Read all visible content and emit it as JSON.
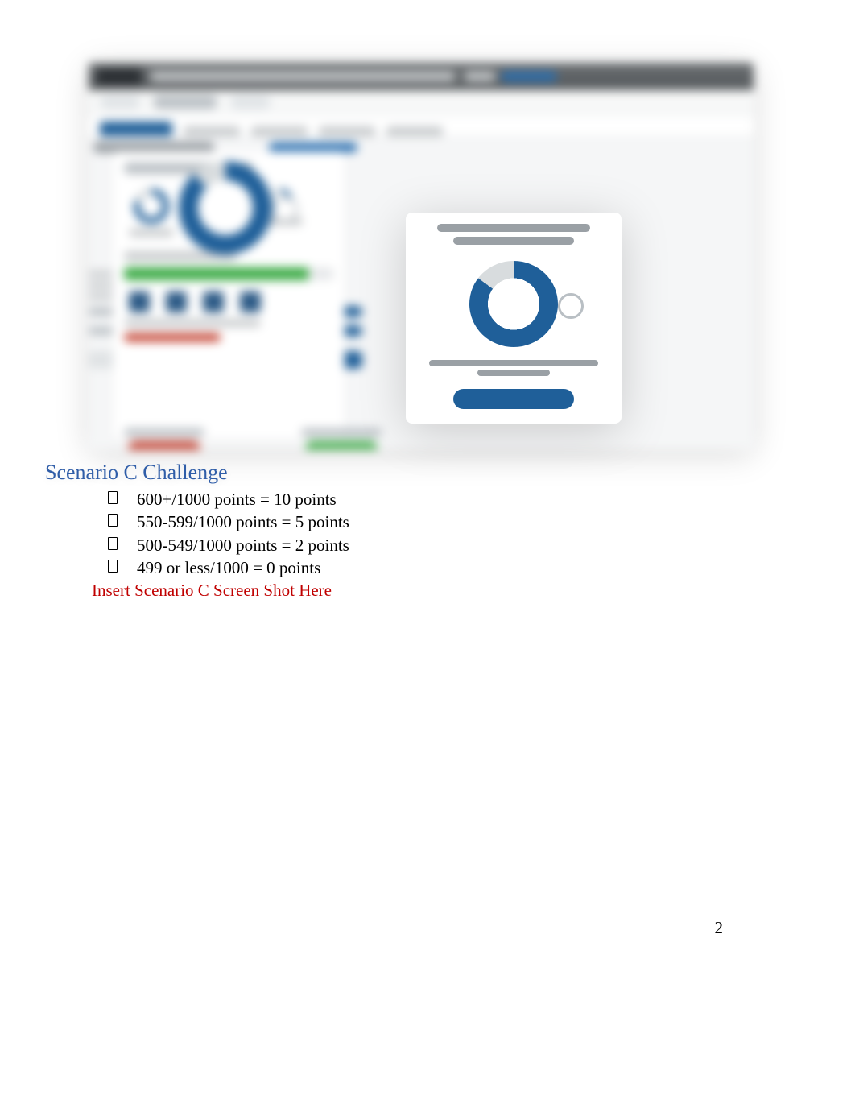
{
  "heading": "Scenario C Challenge",
  "bullets": [
    "600+/1000 points = 10 points",
    "550-599/1000 points = 5 points",
    "500-549/1000 points = 2 points",
    "499 or less/1000 = 0 points"
  ],
  "insert_note": "Insert Scenario C Screen Shot Here",
  "page_number": "2"
}
